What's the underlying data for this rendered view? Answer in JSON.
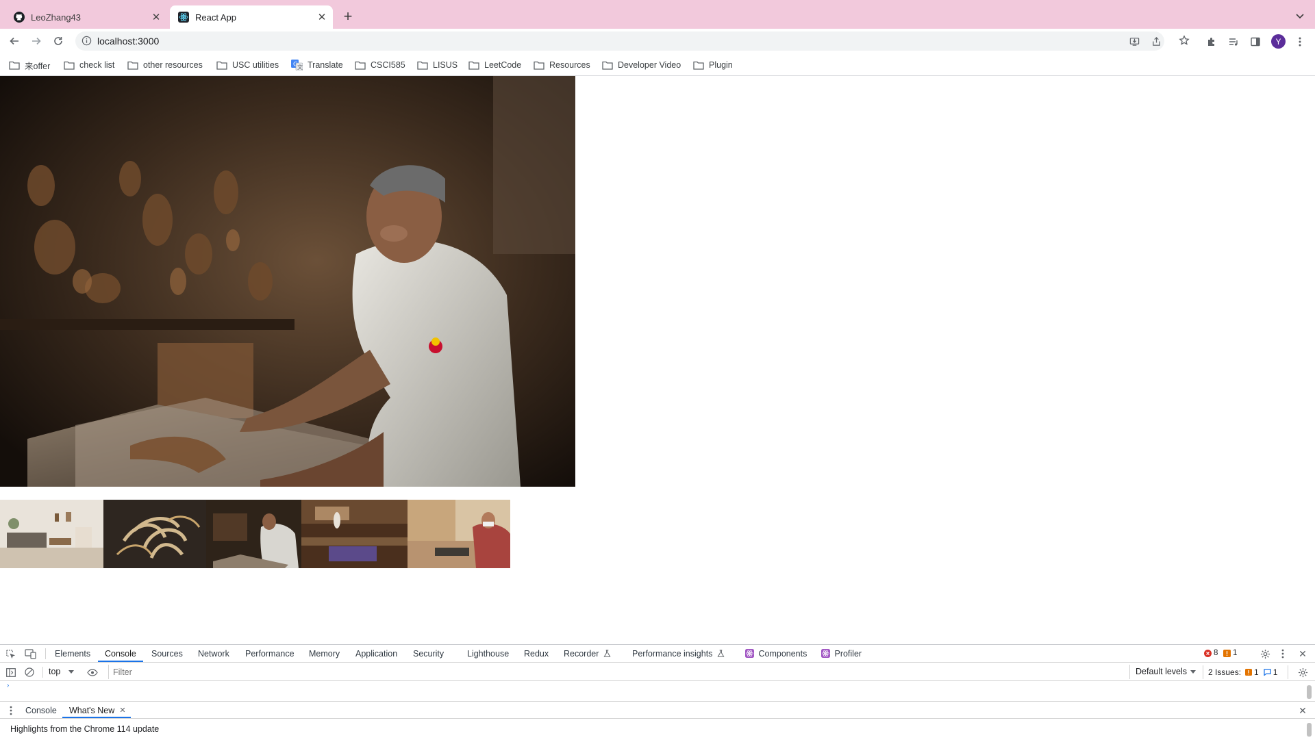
{
  "browser": {
    "tabs": [
      {
        "title": "LeoZhang43",
        "icon": "github-icon"
      },
      {
        "title": "React App",
        "icon": "react-icon"
      }
    ],
    "url": "localhost:3000",
    "profile_initial": "Y"
  },
  "bookmarks": [
    "来offer",
    "check list",
    "other resources",
    "USC utilities",
    "Translate",
    "CSCI585",
    "LISUS",
    "LeetCode",
    "Resources",
    "Developer Video",
    "Plugin"
  ],
  "devtools": {
    "tabs": [
      "Elements",
      "Console",
      "Sources",
      "Network",
      "Performance",
      "Memory",
      "Application",
      "Security",
      "Lighthouse",
      "Redux",
      "Recorder",
      "Performance insights",
      "Components",
      "Profiler"
    ],
    "active_tab": "Console",
    "error_count": "8",
    "warning_count": "1",
    "context": "top",
    "filter_placeholder": "Filter",
    "levels": "Default levels",
    "issues_label": "2 Issues:",
    "issues_warning": "1",
    "issues_info": "1",
    "drawer_tabs": [
      "Console",
      "What's New"
    ],
    "drawer_active": "What's New",
    "whats_new_text": "Highlights from the Chrome 114 update"
  },
  "colors": {
    "tabstrip": "#f2c9dc",
    "accent": "#1a73e8",
    "avatar": "#5b2d9a"
  }
}
